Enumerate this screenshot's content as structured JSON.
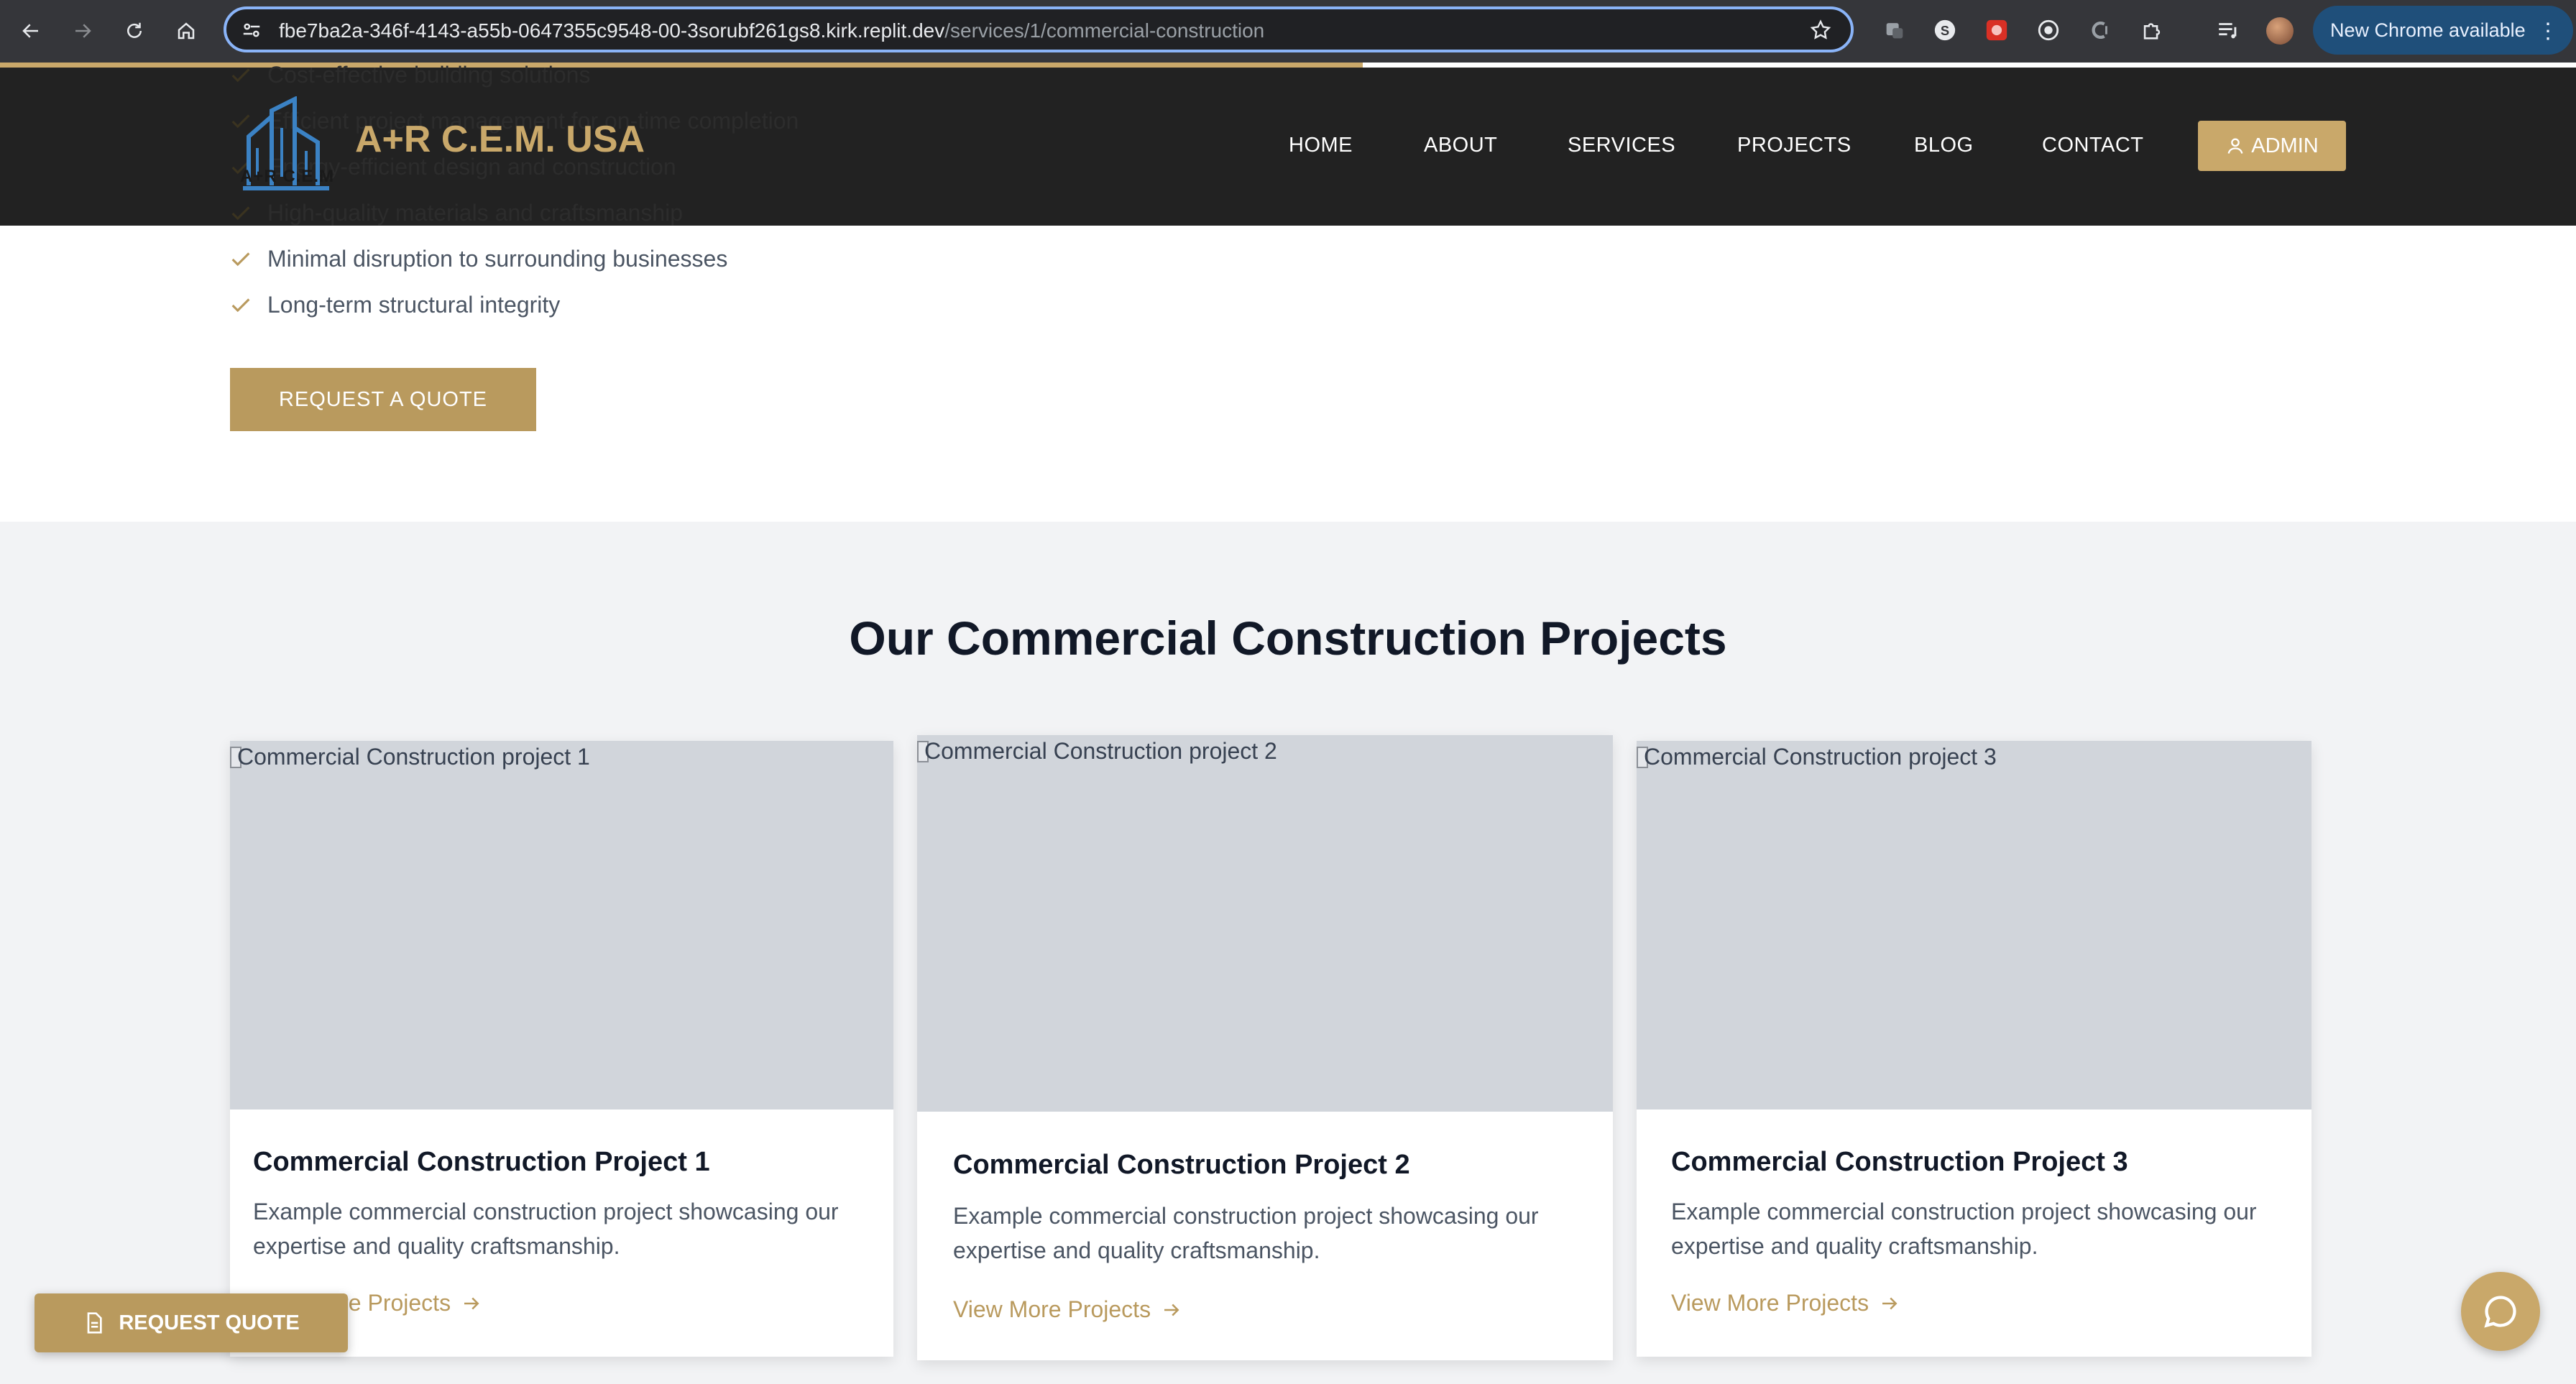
{
  "browser": {
    "url_host": "fbe7ba2a-346f-4143-a55b-0647355c9548-00-3sorubf261gs8.kirk.replit.dev",
    "url_path": "/services/1/commercial-construction",
    "update_label": "New Chrome available"
  },
  "header": {
    "logo_small_text": "A+R C.E.M",
    "brand": "A+R C.E.M. USA",
    "nav": [
      "HOME",
      "ABOUT",
      "SERVICES",
      "PROJECTS",
      "BLOG",
      "CONTACT"
    ],
    "admin_label": "ADMIN"
  },
  "benefits": [
    "Cost-effective building solutions",
    "Efficient project management for on-time completion",
    "Energy-efficient design and construction",
    "High-quality materials and craftsmanship",
    "Minimal disruption to surrounding businesses",
    "Long-term structural integrity"
  ],
  "cta": {
    "request_quote": "REQUEST A QUOTE"
  },
  "projects_section": {
    "title": "Our Commercial Construction Projects",
    "projects": [
      {
        "alt": "Commercial Construction project 1",
        "title": "Commercial Construction Project 1",
        "description": "Example commercial construction project showcasing our expertise and quality craftsmanship.",
        "link": "View More Projects"
      },
      {
        "alt": "Commercial Construction project 2",
        "title": "Commercial Construction Project 2",
        "description": "Example commercial construction project showcasing our expertise and quality craftsmanship.",
        "link": "View More Projects"
      },
      {
        "alt": "Commercial Construction project 3",
        "title": "Commercial Construction Project 3",
        "description": "Example commercial construction project showcasing our expertise and quality craftsmanship.",
        "link": "View More Projects"
      }
    ]
  },
  "floating": {
    "request_quote": "REQUEST QUOTE"
  },
  "colors": {
    "gold": "#c9a86a",
    "button_gold": "#b99a5e",
    "header_bg": "#111111",
    "section_bg": "#f2f3f5"
  }
}
